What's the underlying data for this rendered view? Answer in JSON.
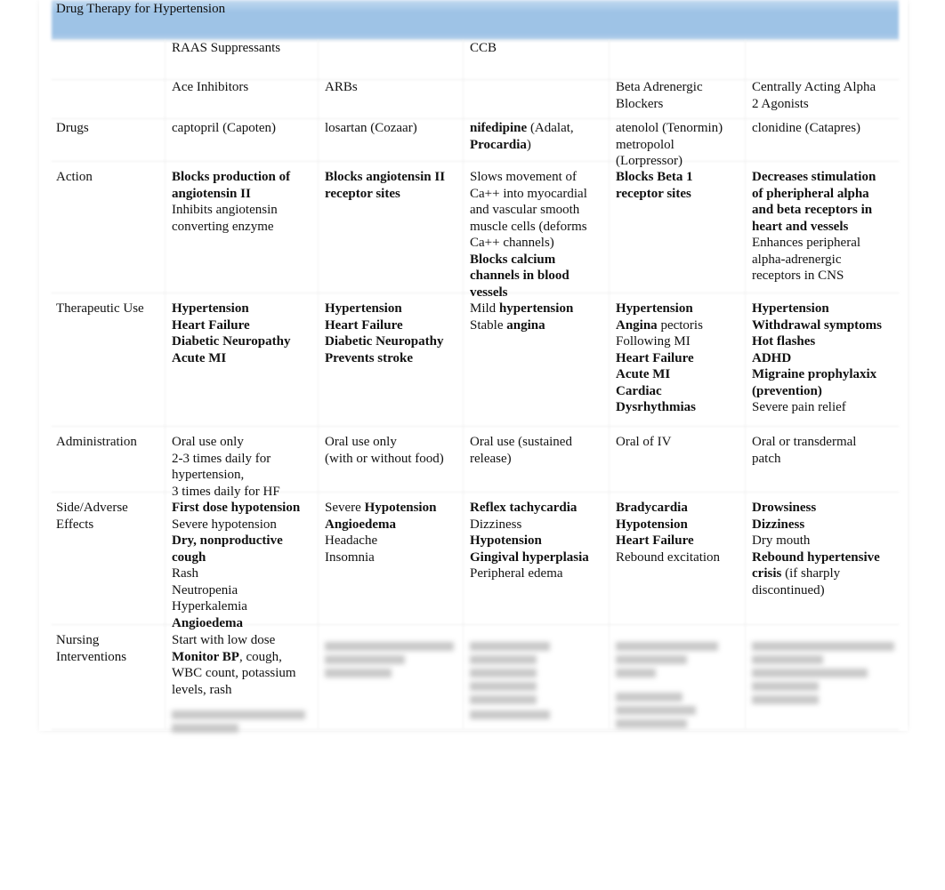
{
  "title": "Drug Therapy for Hypertension",
  "header_groups": [
    "RAAS Suppressants",
    "",
    "CCB",
    "",
    ""
  ],
  "header_classes": [
    [
      "Ace Inhibitors"
    ],
    [
      "ARBs"
    ],
    [
      ""
    ],
    [
      "Beta Adrenergic",
      "Blockers"
    ],
    [
      "Centrally Acting Alpha",
      "2 Agonists"
    ]
  ],
  "rows": [
    {
      "label": [
        "Drugs"
      ],
      "cells": [
        [
          [
            {
              "text": "captopril (Capoten)"
            }
          ]
        ],
        [
          [
            {
              "text": "losartan (Cozaar)"
            }
          ]
        ],
        [
          [
            {
              "text": "nifedipine",
              "bold": true
            },
            {
              "text": " (Adalat,"
            }
          ],
          [
            {
              "text": "Procardia",
              "bold": true
            },
            {
              "text": ")"
            }
          ]
        ],
        [
          [
            {
              "text": "atenolol (Tenormin)"
            }
          ],
          [
            {
              "text": "metropolol"
            }
          ],
          [
            {
              "text": "(Lorpressor)"
            }
          ]
        ],
        [
          [
            {
              "text": "clonidine (Catapres)"
            }
          ]
        ]
      ]
    },
    {
      "label": [
        "Action"
      ],
      "cells": [
        [
          [
            {
              "text": "Blocks production of",
              "bold": true
            }
          ],
          [
            {
              "text": "angiotensin II",
              "bold": true
            }
          ],
          [
            {
              "text": "Inhibits angiotensin"
            }
          ],
          [
            {
              "text": "converting enzyme"
            }
          ]
        ],
        [
          [
            {
              "text": "Blocks angiotensin II",
              "bold": true
            }
          ],
          [
            {
              "text": "receptor sites",
              "bold": true
            }
          ]
        ],
        [
          [
            {
              "text": "Slows movement of"
            }
          ],
          [
            {
              "text": "Ca++ into myocardial"
            }
          ],
          [
            {
              "text": "and vascular smooth"
            }
          ],
          [
            {
              "text": "muscle cells (deforms"
            }
          ],
          [
            {
              "text": "Ca++ channels)"
            }
          ],
          [
            {
              "text": "Blocks calcium",
              "bold": true
            }
          ],
          [
            {
              "text": "channels in blood",
              "bold": true
            }
          ],
          [
            {
              "text": "vessels",
              "bold": true
            }
          ]
        ],
        [
          [
            {
              "text": "Blocks Beta 1",
              "bold": true
            }
          ],
          [
            {
              "text": "receptor sites",
              "bold": true
            }
          ]
        ],
        [
          [
            {
              "text": "Decreases stimulation",
              "bold": true
            }
          ],
          [
            {
              "text": "of pheripheral alpha",
              "bold": true
            }
          ],
          [
            {
              "text": "and beta receptors in",
              "bold": true
            }
          ],
          [
            {
              "text": "heart and vessels",
              "bold": true
            }
          ],
          [
            {
              "text": "Enhances peripheral"
            }
          ],
          [
            {
              "text": "alpha-adrenergic"
            }
          ],
          [
            {
              "text": "receptors in CNS"
            }
          ]
        ]
      ]
    },
    {
      "label": [
        "Therapeutic Use"
      ],
      "cells": [
        [
          [
            {
              "text": "Hypertension",
              "bold": true
            }
          ],
          [
            {
              "text": "Heart Failure",
              "bold": true
            }
          ],
          [
            {
              "text": "Diabetic Neuropathy",
              "bold": true
            }
          ],
          [
            {
              "text": "Acute MI",
              "bold": true
            }
          ]
        ],
        [
          [
            {
              "text": "Hypertension",
              "bold": true
            }
          ],
          [
            {
              "text": "Heart Failure",
              "bold": true
            }
          ],
          [
            {
              "text": "Diabetic Neuropathy",
              "bold": true
            }
          ],
          [
            {
              "text": "Prevents stroke",
              "bold": true
            }
          ]
        ],
        [
          [
            {
              "text": "Mild "
            },
            {
              "text": "hypertension",
              "bold": true
            }
          ],
          [
            {
              "text": "Stable "
            },
            {
              "text": "angina",
              "bold": true
            }
          ]
        ],
        [
          [
            {
              "text": "Hypertension",
              "bold": true
            }
          ],
          [
            {
              "text": "Angina",
              "bold": true
            },
            {
              "text": " pectoris"
            }
          ],
          [
            {
              "text": "Following MI"
            }
          ],
          [
            {
              "text": "Heart Failure",
              "bold": true
            }
          ],
          [
            {
              "text": "Acute MI",
              "bold": true
            }
          ],
          [
            {
              "text": "Cardiac",
              "bold": true
            }
          ],
          [
            {
              "text": "Dysrhythmias",
              "bold": true
            }
          ]
        ],
        [
          [
            {
              "text": "Hypertension",
              "bold": true
            }
          ],
          [
            {
              "text": "Withdrawal symptoms",
              "bold": true
            }
          ],
          [
            {
              "text": "Hot flashes",
              "bold": true
            }
          ],
          [
            {
              "text": "ADHD",
              "bold": true
            }
          ],
          [
            {
              "text": "Migraine prophylaxix",
              "bold": true
            }
          ],
          [
            {
              "text": "(prevention)",
              "bold": true
            }
          ],
          [
            {
              "text": "Severe pain relief"
            }
          ]
        ]
      ]
    },
    {
      "label": [
        "Administration"
      ],
      "cells": [
        [
          [
            {
              "text": "Oral use only"
            }
          ],
          [
            {
              "text": "2-3 times daily for"
            }
          ],
          [
            {
              "text": "hypertension,"
            }
          ],
          [
            {
              "text": "3 times daily for HF"
            }
          ]
        ],
        [
          [
            {
              "text": "Oral use only"
            }
          ],
          [
            {
              "text": "(with or without food)"
            }
          ]
        ],
        [
          [
            {
              "text": "Oral use (sustained"
            }
          ],
          [
            {
              "text": "release)"
            }
          ]
        ],
        [
          [
            {
              "text": "Oral of IV"
            }
          ]
        ],
        [
          [
            {
              "text": "Oral or transdermal"
            }
          ],
          [
            {
              "text": "patch"
            }
          ]
        ]
      ]
    },
    {
      "label": [
        "Side/Adverse",
        "Effects"
      ],
      "cells": [
        [
          [
            {
              "text": "First dose hypotension",
              "bold": true
            }
          ],
          [
            {
              "text": "Severe hypotension"
            }
          ],
          [
            {
              "text": "Dry, nonproductive",
              "bold": true
            }
          ],
          [
            {
              "text": "cough",
              "bold": true
            }
          ],
          [
            {
              "text": "Rash"
            }
          ],
          [
            {
              "text": "Neutropenia"
            }
          ],
          [
            {
              "text": "Hyperkalemia"
            }
          ],
          [
            {
              "text": "Angioedema",
              "bold": true
            }
          ]
        ],
        [
          [
            {
              "text": "Severe "
            },
            {
              "text": "Hypotension",
              "bold": true
            }
          ],
          [
            {
              "text": "Angioedema",
              "bold": true
            }
          ],
          [
            {
              "text": "Headache"
            }
          ],
          [
            {
              "text": "Insomnia"
            }
          ]
        ],
        [
          [
            {
              "text": "Reflex tachycardia",
              "bold": true
            }
          ],
          [
            {
              "text": "Dizziness"
            }
          ],
          [
            {
              "text": "Hypotension",
              "bold": true
            }
          ],
          [
            {
              "text": "Gingival hyperplasia",
              "bold": true
            }
          ],
          [
            {
              "text": "Peripheral edema"
            }
          ]
        ],
        [
          [
            {
              "text": "Bradycardia",
              "bold": true
            }
          ],
          [
            {
              "text": "Hypotension",
              "bold": true
            }
          ],
          [
            {
              "text": "Heart Failure",
              "bold": true
            }
          ],
          [
            {
              "text": "Rebound excitation"
            }
          ]
        ],
        [
          [
            {
              "text": "Drowsiness",
              "bold": true
            }
          ],
          [
            {
              "text": "Dizziness",
              "bold": true
            }
          ],
          [
            {
              "text": "Dry mouth"
            }
          ],
          [
            {
              "text": "Rebound hypertensive",
              "bold": true
            }
          ],
          [
            {
              "text": "crisis",
              "bold": true
            },
            {
              "text": " (if sharply"
            }
          ],
          [
            {
              "text": "discontinued)"
            }
          ]
        ]
      ]
    },
    {
      "label": [
        "Nursing",
        "Interventions"
      ],
      "cells": [
        [
          [
            {
              "text": "Start with low dose"
            }
          ],
          [
            {
              "text": "Monitor BP",
              "bold": true
            },
            {
              "text": ", cough,"
            }
          ],
          [
            {
              "text": "WBC count, potassium"
            }
          ],
          [
            {
              "text": "levels, rash"
            }
          ]
        ],
        [],
        [],
        [],
        []
      ]
    }
  ],
  "colors": {
    "title_band": "#9ec3e6"
  }
}
